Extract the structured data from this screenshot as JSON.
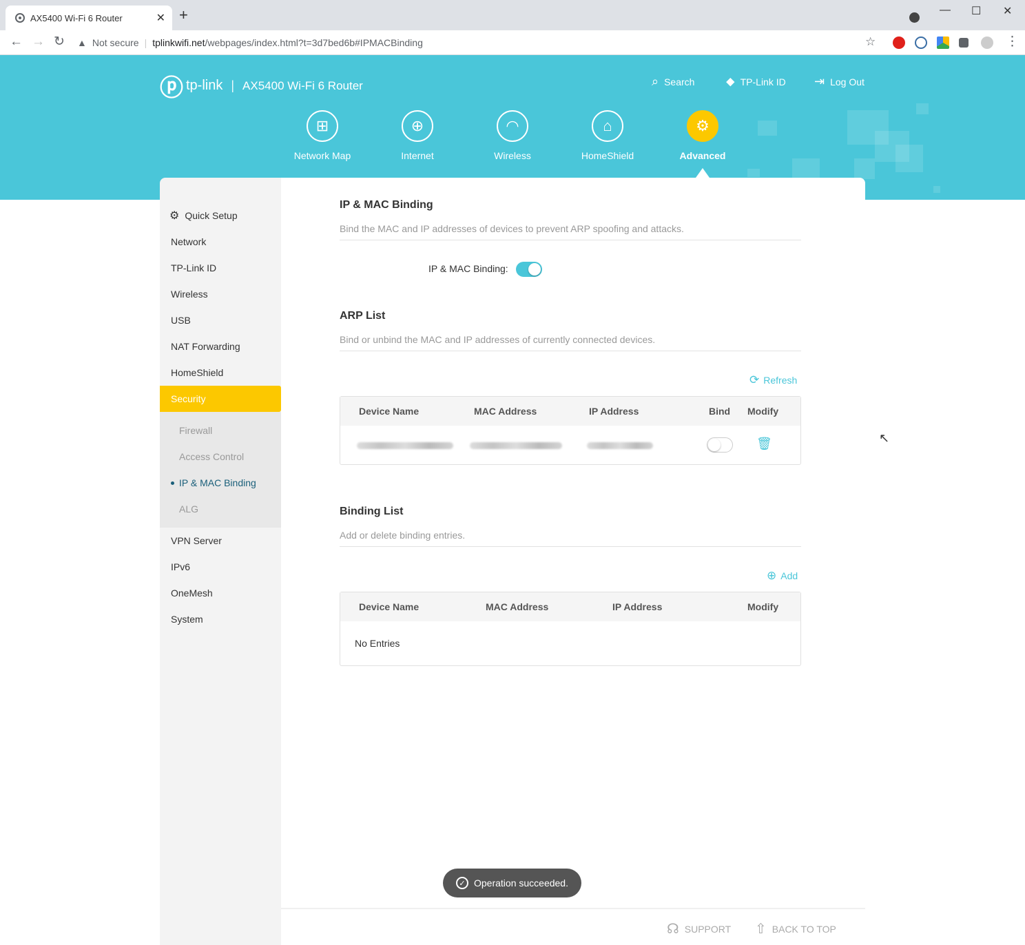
{
  "browser": {
    "tab_title": "AX5400 Wi-Fi 6 Router",
    "tab_close": "✕",
    "new_tab": "+",
    "security_label": "Not secure",
    "url_host": "tplinkwifi.net",
    "url_path": "/webpages/index.html?t=3d7bed6b#IPMACBinding",
    "window_controls": [
      "—",
      "☐",
      "✕"
    ]
  },
  "header": {
    "brand": "tp-link",
    "model": "AX5400 Wi-Fi 6 Router",
    "links": [
      {
        "label": "Search",
        "icon": "search-icon"
      },
      {
        "label": "TP-Link ID",
        "icon": "user-icon"
      },
      {
        "label": "Log Out",
        "icon": "logout-icon"
      }
    ],
    "nav": [
      {
        "label": "Network Map",
        "icon": "network-map-icon",
        "active": false
      },
      {
        "label": "Internet",
        "icon": "globe-icon",
        "active": false
      },
      {
        "label": "Wireless",
        "icon": "wifi-icon",
        "active": false
      },
      {
        "label": "HomeShield",
        "icon": "homeshield-icon",
        "active": false
      },
      {
        "label": "Advanced",
        "icon": "gear-icon",
        "active": true
      }
    ],
    "accent_color": "#4ac6d9",
    "active_color": "#fcc800"
  },
  "sidebar": {
    "items": [
      {
        "label": "Quick Setup",
        "icon": "gear-icon"
      },
      {
        "label": "Network"
      },
      {
        "label": "TP-Link ID"
      },
      {
        "label": "Wireless"
      },
      {
        "label": "USB"
      },
      {
        "label": "NAT Forwarding"
      },
      {
        "label": "HomeShield"
      },
      {
        "label": "Security",
        "active": true
      }
    ],
    "sub_items": [
      {
        "label": "Firewall"
      },
      {
        "label": "Access Control"
      },
      {
        "label": "IP & MAC Binding",
        "active": true
      },
      {
        "label": "ALG"
      }
    ],
    "items_after": [
      {
        "label": "VPN Server"
      },
      {
        "label": "IPv6"
      },
      {
        "label": "OneMesh"
      },
      {
        "label": "System"
      }
    ]
  },
  "main": {
    "binding": {
      "title": "IP & MAC Binding",
      "desc": "Bind the MAC and IP addresses of devices to prevent ARP spoofing and attacks.",
      "toggle_label": "IP & MAC Binding:",
      "enabled": true
    },
    "arp": {
      "title": "ARP List",
      "desc": "Bind or unbind the MAC and IP addresses of currently connected devices.",
      "refresh_label": "Refresh",
      "columns": [
        "Device Name",
        "MAC Address",
        "IP Address",
        "Bind",
        "Modify"
      ],
      "rows": [
        {
          "device_name": "",
          "mac": "",
          "ip": "",
          "bound": false
        }
      ]
    },
    "binding_list": {
      "title": "Binding List",
      "desc": "Add or delete binding entries.",
      "add_label": "Add",
      "columns": [
        "Device Name",
        "MAC Address",
        "IP Address",
        "Modify"
      ],
      "empty_text": "No Entries"
    }
  },
  "toast": {
    "text": "Operation succeeded."
  },
  "footer": {
    "support_label": "SUPPORT",
    "back_to_top_label": "BACK TO TOP"
  }
}
